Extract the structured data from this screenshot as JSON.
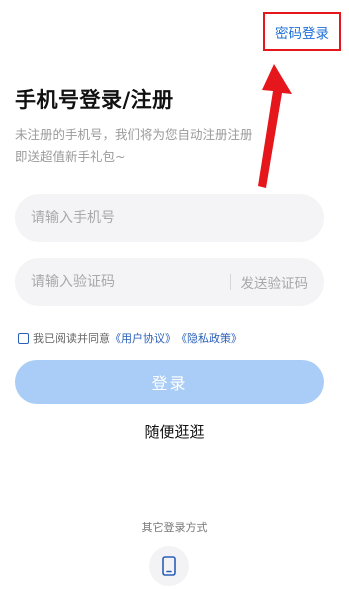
{
  "header": {
    "password_login_label": "密码登录"
  },
  "title": "手机号登录/注册",
  "subtitle": "未注册的手机号，我们将为您自动注册注册即送超值新手礼包~",
  "phone_input": {
    "placeholder": "请输入手机号",
    "value": ""
  },
  "code_input": {
    "placeholder": "请输入验证码",
    "value": ""
  },
  "send_code_label": "发送验证码",
  "agreement": {
    "prefix": "我已阅读并同意",
    "user_agreement": "《用户协议》",
    "privacy_policy": "《隐私政策》",
    "checked": false
  },
  "login_button_label": "登录",
  "browse_label": "随便逛逛",
  "other_login_label": "其它登录方式",
  "other_login_methods": [
    "phone-icon"
  ],
  "colors": {
    "accent": "#1e6fd9",
    "login_button_disabled": "#a9cdf7",
    "highlight": "#e5161c"
  }
}
